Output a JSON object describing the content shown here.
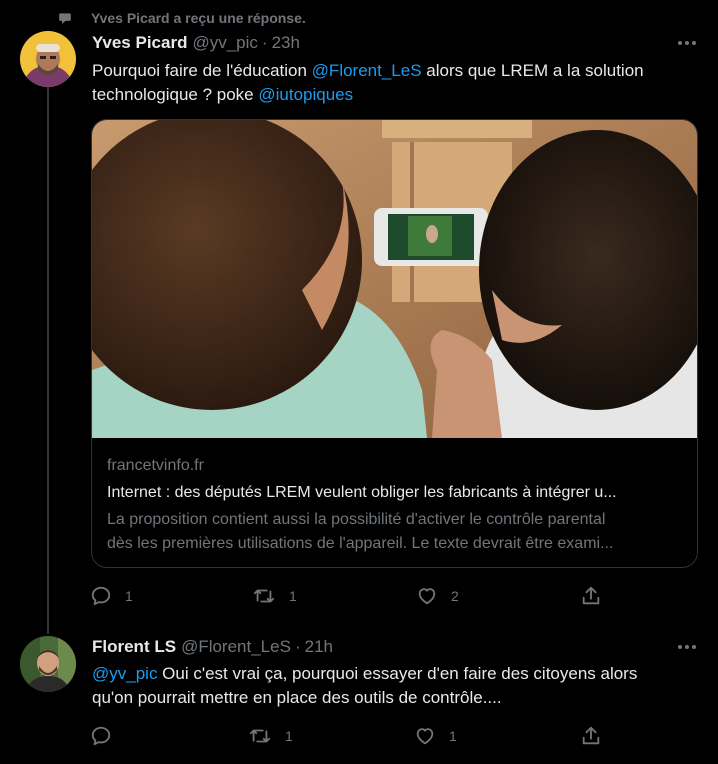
{
  "context": {
    "text": "Yves Picard a reçu une réponse."
  },
  "tweets": [
    {
      "name": "Yves Picard",
      "handle": "@yv_pic",
      "separator": "·",
      "time": "23h",
      "text": {
        "p1": "Pourquoi faire de l'éducation ",
        "m1": "@Florent_LeS",
        "p2": " alors que LREM a la solution technologique ? poke ",
        "m2": "@iutopiques"
      },
      "card": {
        "domain": "francetvinfo.fr",
        "title": "Internet : des députés LREM veulent obliger les fabricants à intégrer u...",
        "desc1": "La proposition contient aussi la possibilité d'activer le contrôle parental",
        "desc2": "dès les premières utilisations de l'appareil. Le texte devrait être exami..."
      },
      "actions": {
        "replies": "1",
        "retweets": "1",
        "likes": "2"
      }
    },
    {
      "name": "Florent LS",
      "handle": "@Florent_LeS",
      "separator": "·",
      "time": "21h",
      "text": {
        "m1": "@yv_pic",
        "p1": " Oui c'est vrai ça, pourquoi essayer d'en faire des citoyens alors qu'on pourrait mettre en place des outils de contrôle...."
      },
      "actions": {
        "replies": "",
        "retweets": "1",
        "likes": "1"
      }
    }
  ],
  "colors": {
    "background": "#000000",
    "text": "#e7e9ea",
    "secondary": "#71767b",
    "accent": "#1d9bf0",
    "border": "#2f3336"
  },
  "icons": [
    "chat-bubble-icon",
    "more-icon",
    "reply-icon",
    "retweet-icon",
    "like-icon",
    "share-icon"
  ]
}
